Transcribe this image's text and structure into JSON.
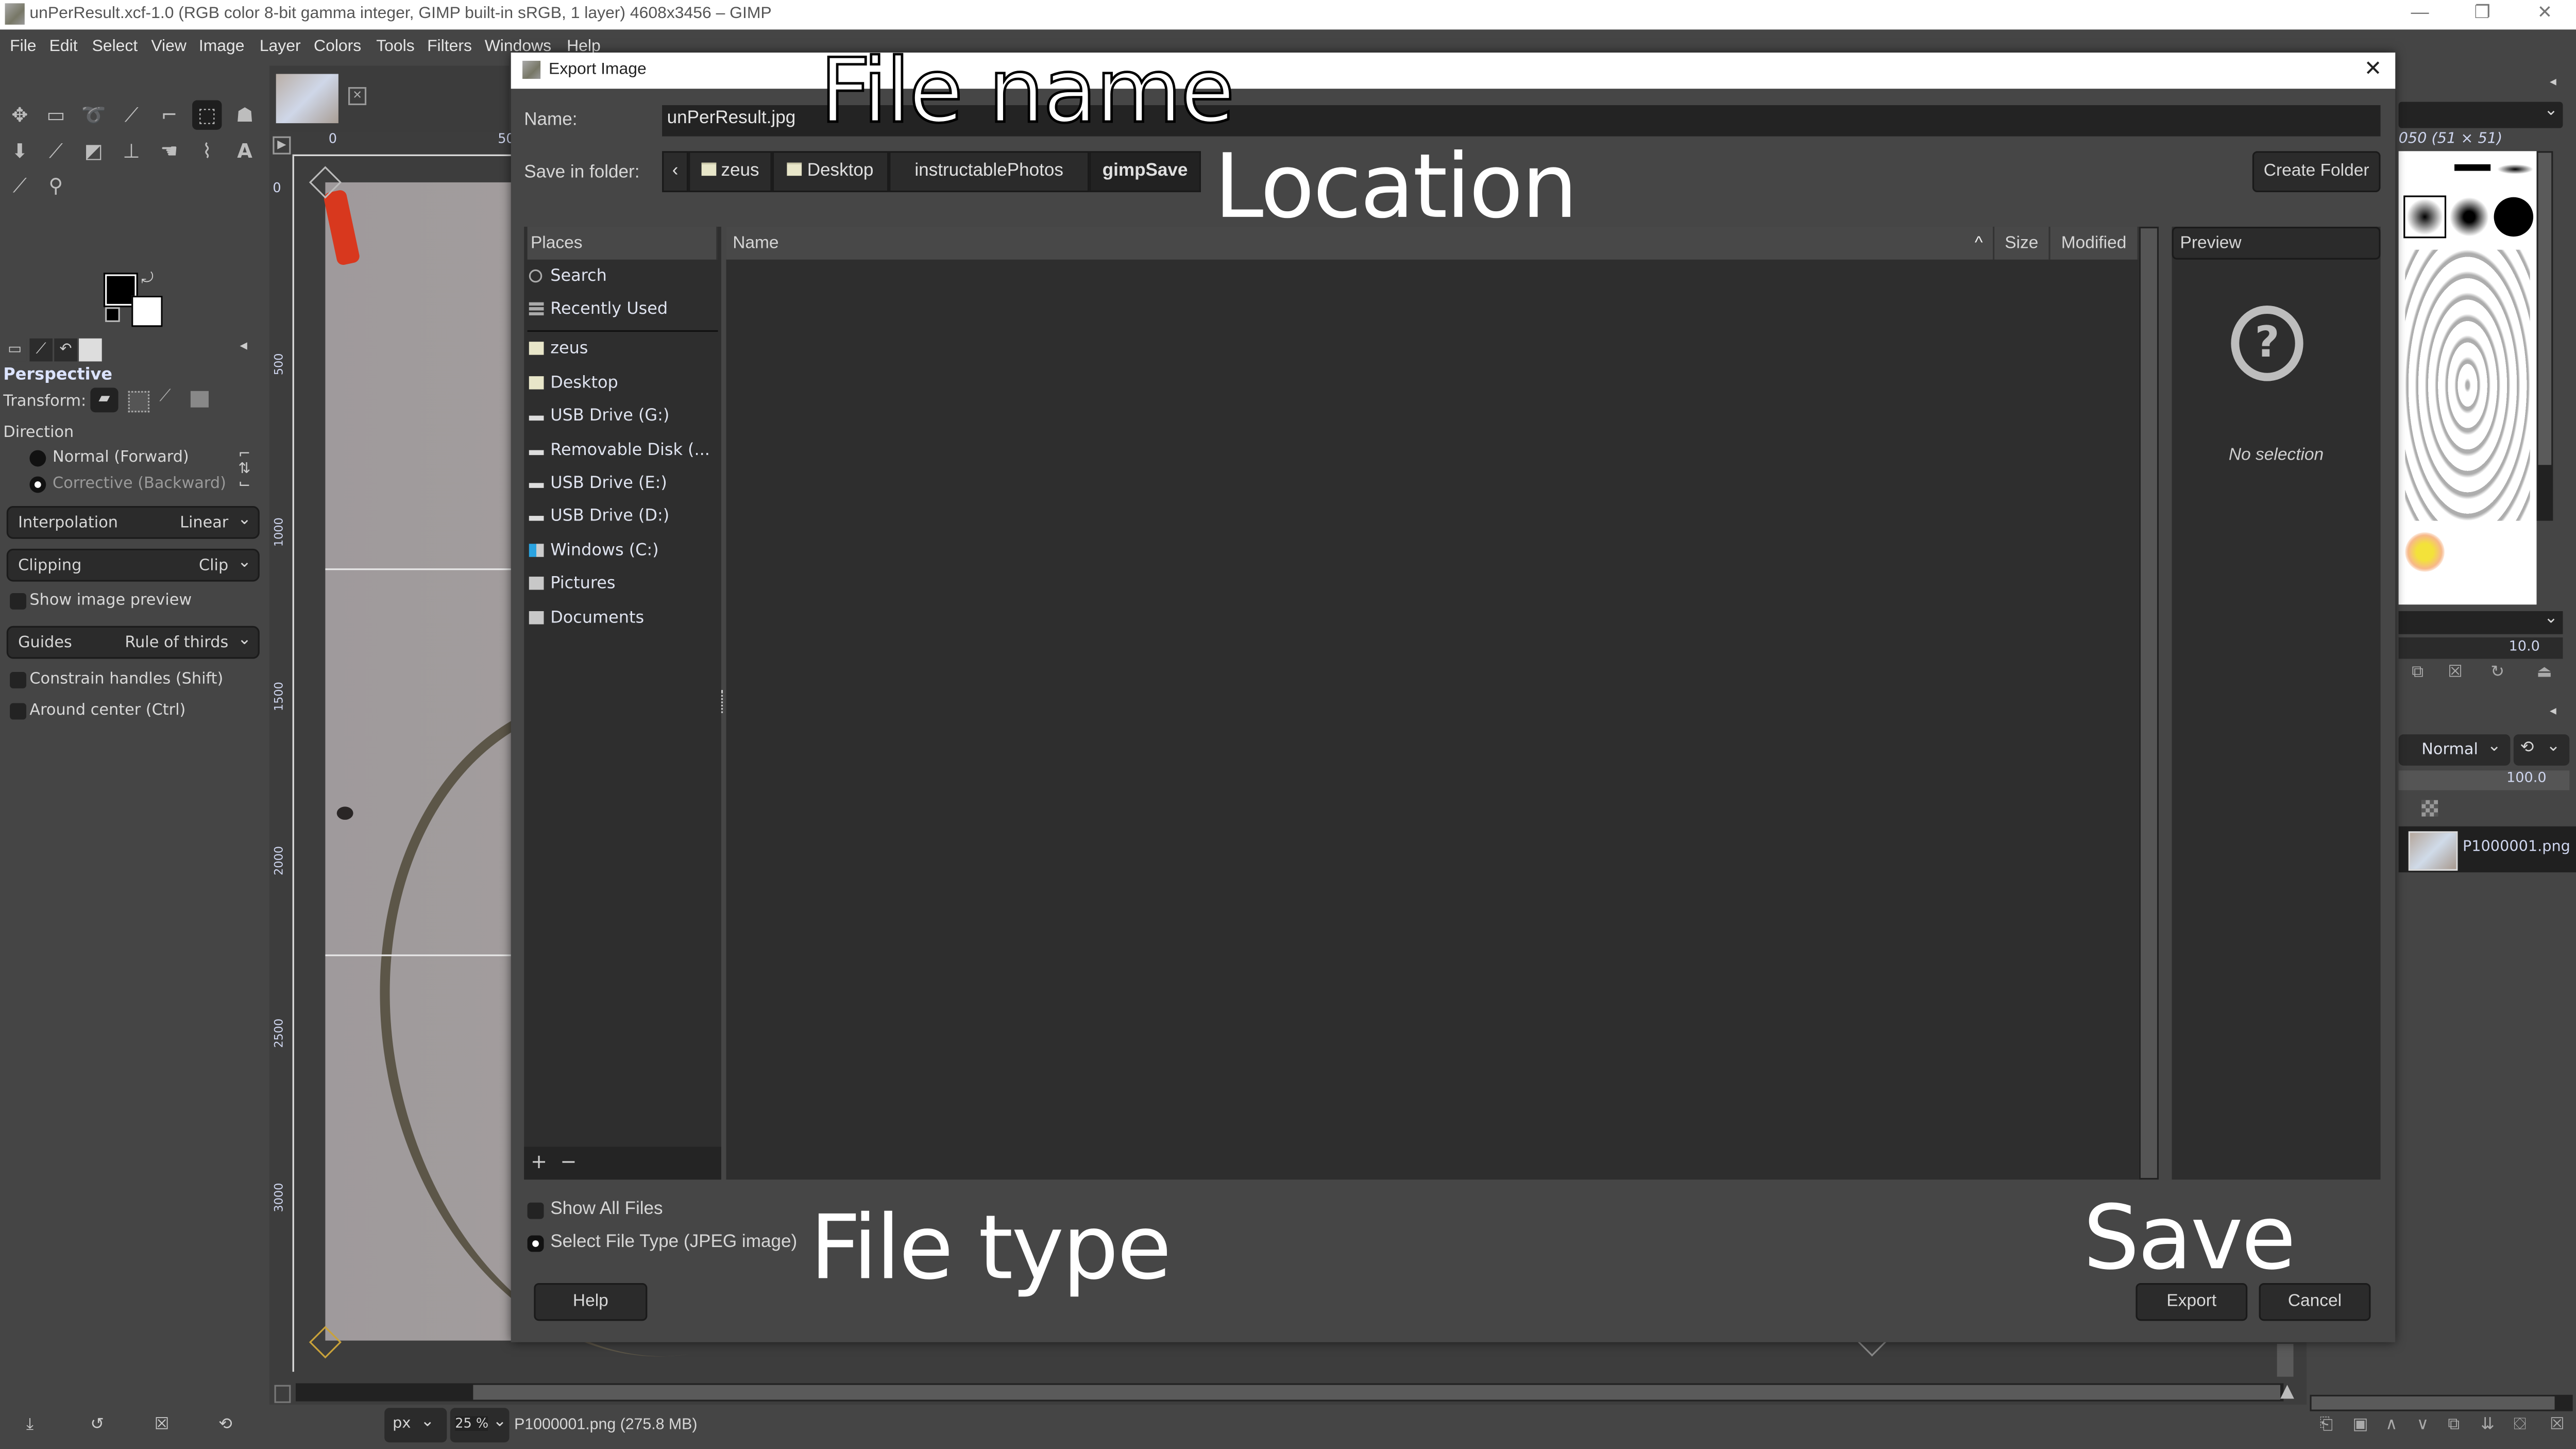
{
  "window": {
    "title": "unPerResult.xcf-1.0 (RGB color 8-bit gamma integer, GIMP built-in sRGB, 1 layer) 4608x3456 – GIMP",
    "controls": [
      "minimize",
      "restore",
      "close"
    ]
  },
  "menubar": [
    "File",
    "Edit",
    "Select",
    "View",
    "Image",
    "Layer",
    "Colors",
    "Tools",
    "Filters",
    "Windows",
    "Help"
  ],
  "toolbox": {
    "tools": [
      "move-tool",
      "rect-select-tool",
      "free-select-tool",
      "fuzzy-select-tool",
      "crop-tool",
      "perspective-tool",
      "warp-tool",
      "bucket-fill-tool",
      "paintbrush-tool",
      "eraser-tool",
      "clone-tool",
      "smudge-tool",
      "paths-tool",
      "text-tool",
      "color-picker-tool",
      "zoom-tool"
    ],
    "active_tool": "perspective-tool",
    "foreground_color": "#000000",
    "background_color": "#ffffff"
  },
  "tool_options": {
    "title": "Perspective",
    "transform_label": "Transform:",
    "direction_label": "Direction",
    "direction_options": [
      "Normal (Forward)",
      "Corrective (Backward)"
    ],
    "direction_selected": "Corrective (Backward)",
    "interpolation_label": "Interpolation",
    "interpolation_value": "Linear",
    "clipping_label": "Clipping",
    "clipping_value": "Clip",
    "show_preview_label": "Show image preview",
    "guides_label": "Guides",
    "guides_value": "Rule of thirds",
    "constrain_label": "Constrain handles (Shift)",
    "around_center_label": "Around center (Ctrl)"
  },
  "canvas": {
    "ruler_h_labels": [
      "0",
      "50"
    ],
    "ruler_v_labels": [
      "0",
      "500",
      "1000",
      "1500",
      "2000",
      "2500",
      "3000"
    ],
    "unit": "px",
    "zoom": "25 %",
    "status": "P1000001.png (275.8 MB)"
  },
  "right_dock": {
    "brush_name": "050 (51 × 51)",
    "brush_spacing": "10.0",
    "layer_mode": "Normal",
    "opacity": "100.0",
    "layers": [
      {
        "name": "P1000001.png"
      }
    ]
  },
  "dialog": {
    "title": "Export Image",
    "name_label": "Name:",
    "name_value": "unPerResult.jpg",
    "save_in_label": "Save in folder:",
    "breadcrumbs": [
      {
        "label": "zeus",
        "folder": true
      },
      {
        "label": "Desktop",
        "folder": true
      },
      {
        "label": "instructablePhotos",
        "folder": false
      },
      {
        "label": "gimpSave",
        "folder": false,
        "current": true
      }
    ],
    "create_folder": "Create Folder",
    "places_header": "Places",
    "places": [
      {
        "label": "Search",
        "icon": "search-icon"
      },
      {
        "label": "Recently Used",
        "icon": "recent-icon"
      },
      {
        "label": "zeus",
        "icon": "folder-icon"
      },
      {
        "label": "Desktop",
        "icon": "folder-icon"
      },
      {
        "label": "USB Drive (G:)",
        "icon": "drive-icon"
      },
      {
        "label": "Removable Disk (...",
        "icon": "drive-icon"
      },
      {
        "label": "USB Drive (E:)",
        "icon": "drive-icon"
      },
      {
        "label": "USB Drive (D:)",
        "icon": "drive-icon"
      },
      {
        "label": "Windows (C:)",
        "icon": "system-drive-icon"
      },
      {
        "label": "Pictures",
        "icon": "folder-gray-icon"
      },
      {
        "label": "Documents",
        "icon": "folder-gray-icon"
      }
    ],
    "columns": [
      "Name",
      "Size",
      "Modified"
    ],
    "sort_indicator": "^",
    "preview_header": "Preview",
    "preview_empty": "No selection",
    "show_all_files": "Show All Files",
    "select_file_type": "Select File Type (JPEG image)",
    "help": "Help",
    "export": "Export",
    "cancel": "Cancel"
  },
  "annotations": {
    "file_name": "File name",
    "location": "Location",
    "file_type": "File type",
    "save": "Save"
  }
}
